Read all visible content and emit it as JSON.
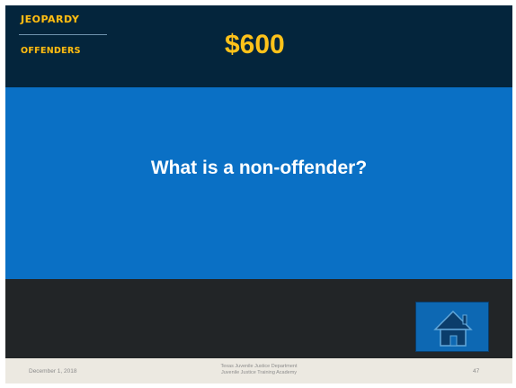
{
  "header": {
    "game_title": "Jeopardy",
    "category": "Offenders",
    "value": "$600"
  },
  "main": {
    "answer_text": "What is a non-offender?"
  },
  "navigation": {
    "home_icon": "home-icon"
  },
  "footer": {
    "date": "December 1, 2018",
    "organization_line1": "Texas Juvenile Justice Department",
    "organization_line2": "Juvenile Justice Training Academy",
    "page_number": "47"
  },
  "colors": {
    "header_background": "#04253c",
    "panel_blue": "#0a70c5",
    "accent_gold": "#ffc21a",
    "bottom_band": "#222527",
    "footer_background": "#ece9e1"
  }
}
